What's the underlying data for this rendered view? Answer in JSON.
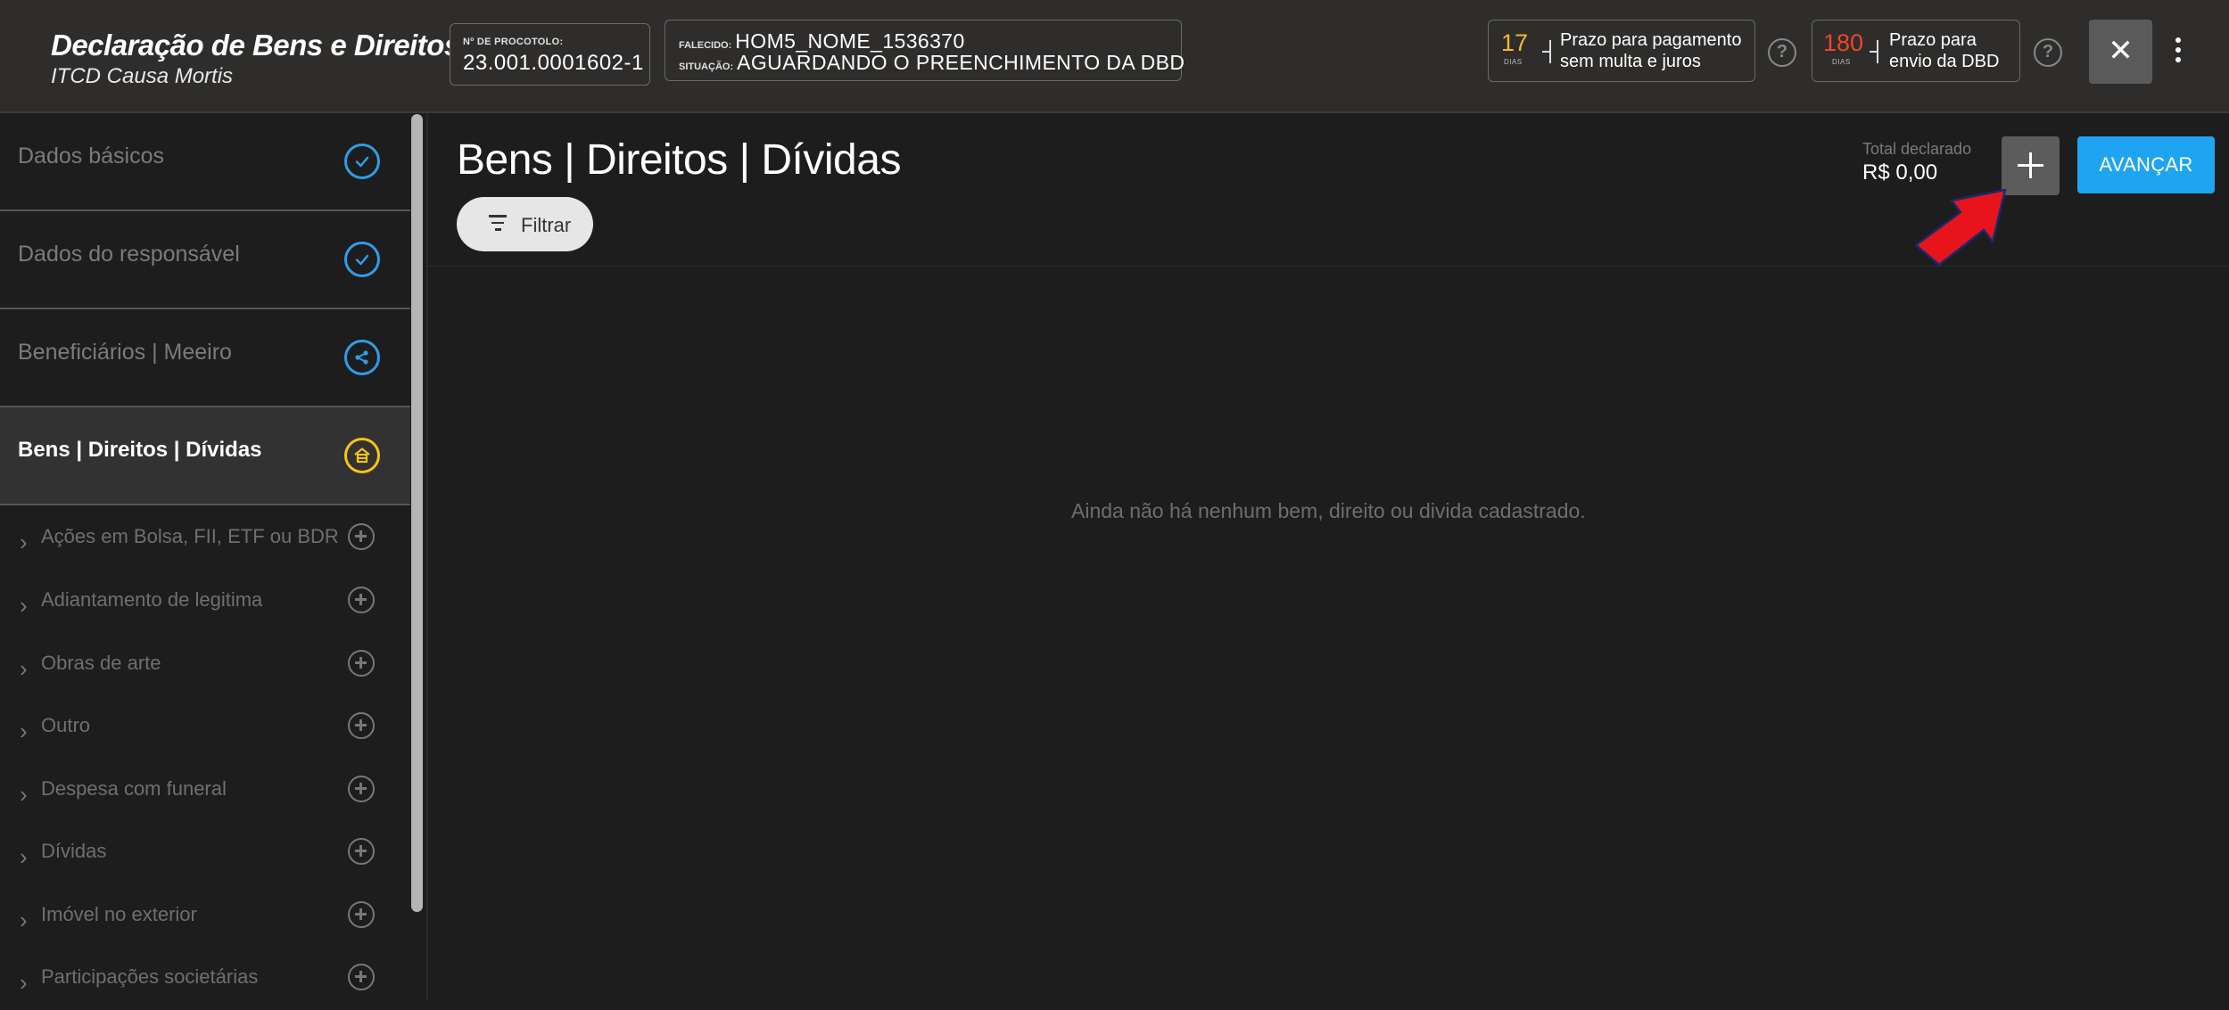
{
  "header": {
    "title": "Declaração de Bens e Direitos",
    "subtitle": "ITCD Causa Mortis",
    "protocol_label": "Nº DE PROCOTOLO:",
    "protocol_value": "23.001.0001602-1",
    "deceased_label": "FALECIDO:",
    "deceased_value": "HOM5_NOME_1536370",
    "status_label": "SITUAÇÃO:",
    "status_value": "AGUARDANDO O PREENCHIMENTO DA DBD",
    "deadline_payment": {
      "days": "17",
      "unit": "DIAS",
      "line1": "Prazo para pagamento",
      "line2": "sem multa e juros",
      "color": "#f5b82e"
    },
    "deadline_submission": {
      "days": "180",
      "unit": "DIAS",
      "line1": "Prazo para",
      "line2": "envio da DBD",
      "color": "#f0452b"
    },
    "help_icon": "?",
    "close_icon": "✕"
  },
  "sidebar": {
    "steps": [
      {
        "label": "Dados básicos",
        "icon": "check-circle-icon",
        "state": "done"
      },
      {
        "label": "Dados do responsável",
        "icon": "check-circle-icon",
        "state": "done"
      },
      {
        "label": "Beneficiários | Meeiro",
        "icon": "share-circle-icon",
        "state": "pending"
      },
      {
        "label": "Bens | Direitos | Dívidas",
        "icon": "house-circle-icon",
        "state": "active"
      }
    ],
    "categories": [
      {
        "label": "Ações em Bolsa, FII, ETF ou BDR"
      },
      {
        "label": "Adiantamento de legitima"
      },
      {
        "label": "Obras de arte"
      },
      {
        "label": "Outro"
      },
      {
        "label": "Despesa com funeral"
      },
      {
        "label": "Dívidas"
      },
      {
        "label": "Imóvel no exterior"
      },
      {
        "label": "Participações societárias"
      }
    ],
    "chevron": "›"
  },
  "main": {
    "title": "Bens | Direitos | Dívidas",
    "filter_label": "Filtrar",
    "total_label": "Total declarado",
    "total_value": "R$ 0,00",
    "next_label": "AVANÇAR",
    "empty_message": "Ainda não há nenhum bem, direito ou divida cadastrado."
  },
  "colors": {
    "accent_blue": "#1fa4f2",
    "check_blue": "#2f9de8",
    "active_yellow": "#f5c518",
    "annotation_red": "#e8141c"
  }
}
